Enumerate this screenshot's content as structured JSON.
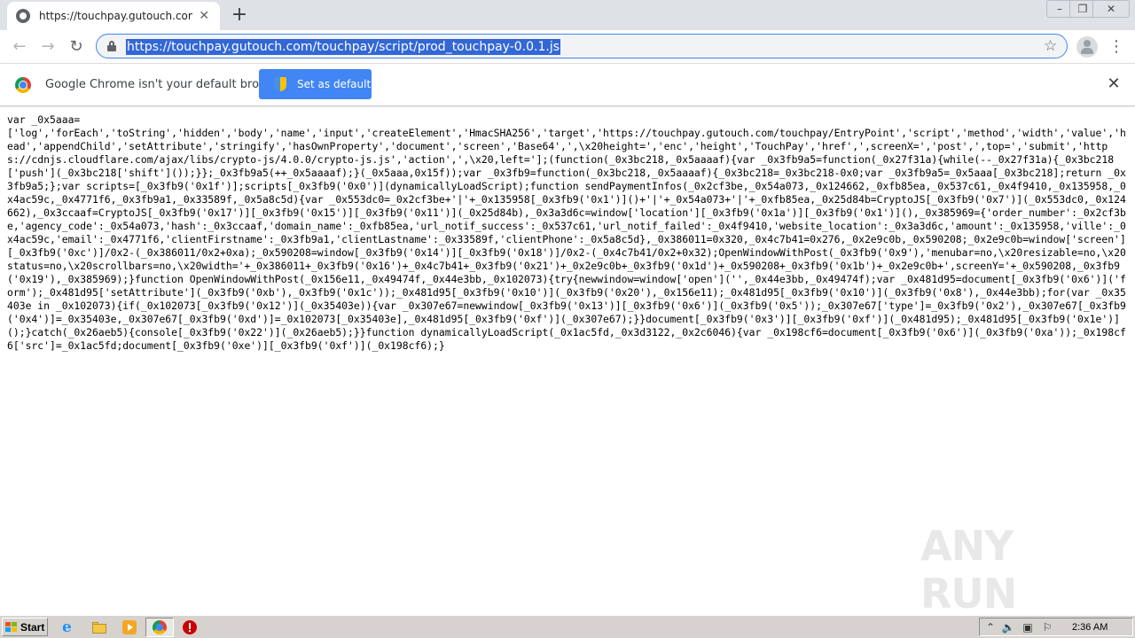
{
  "browser": {
    "tab": {
      "title": "https://touchpay.gutouch.com/touc",
      "close_glyph": "✕",
      "new_tab_glyph": "+"
    },
    "window_controls": {
      "minimize": "–",
      "maximize": "❐",
      "close": "✕"
    },
    "toolbar": {
      "back_glyph": "←",
      "forward_glyph": "→",
      "reload_glyph": "↻",
      "url": "https://touchpay.gutouch.com/touchpay/script/prod_touchpay-0.0.1.js",
      "star_glyph": "☆",
      "menu_glyph": "⋮"
    },
    "infobar": {
      "message": "Google Chrome isn't your default browser",
      "button_label": "Set as default",
      "close_glyph": "✕"
    }
  },
  "page": {
    "source_text": "var _0x5aaa=\n['log','forEach','toString','hidden','body','name','input','createElement','HmacSHA256','target','https://touchpay.gutouch.com/touchpay/EntryPoint','script','method','width','value','head','appendChild','setAttribute','stringify','hasOwnProperty','document','screen','Base64',',\\x20height=','enc','height','TouchPay','href',',screenX=','post',',top=','submit','https://cdnjs.cloudflare.com/ajax/libs/crypto-js/4.0.0/crypto-js.js','action',',\\x20,left='];(function(_0x3bc218,_0x5aaaaf){var _0x3fb9a5=function(_0x27f31a){while(--_0x27f31a){_0x3bc218['push'](_0x3bc218['shift']());}};_0x3fb9a5(++_0x5aaaaf);}(_0x5aaa,0x15f));var _0x3fb9=function(_0x3bc218,_0x5aaaaf){_0x3bc218=_0x3bc218-0x0;var _0x3fb9a5=_0x5aaa[_0x3bc218];return _0x3fb9a5;};var scripts=[_0x3fb9('0x1f')];scripts[_0x3fb9('0x0')](dynamicallyLoadScript);function sendPaymentInfos(_0x2cf3be,_0x54a073,_0x124662,_0xfb85ea,_0x537c61,_0x4f9410,_0x135958,_0x4ac59c,_0x4771f6,_0x3fb9a1,_0x33589f,_0x5a8c5d){var _0x553dc0=_0x2cf3be+'|'+_0x135958[_0x3fb9('0x1')]()+'|'+_0x54a073+'|'+_0xfb85ea,_0x25d84b=CryptoJS[_0x3fb9('0x7')](_0x553dc0,_0x124662),_0x3ccaaf=CryptoJS[_0x3fb9('0x17')][_0x3fb9('0x15')][_0x3fb9('0x11')](_0x25d84b),_0x3a3d6c=window['location'][_0x3fb9('0x1a')][_0x3fb9('0x1')](),_0x385969={'order_number':_0x2cf3be,'agency_code':_0x54a073,'hash':_0x3ccaaf,'domain_name':_0xfb85ea,'url_notif_success':_0x537c61,'url_notif_failed':_0x4f9410,'website_location':_0x3a3d6c,'amount':_0x135958,'ville':_0x4ac59c,'email':_0x4771f6,'clientFirstname':_0x3fb9a1,'clientLastname':_0x33589f,'clientPhone':_0x5a8c5d},_0x386011=0x320,_0x4c7b41=0x276,_0x2e9c0b,_0x590208;_0x2e9c0b=window['screen'][_0x3fb9('0xc')]/0x2-(_0x386011/0x2+0xa);_0x590208=window[_0x3fb9('0x14')][_0x3fb9('0x18')]/0x2-(_0x4c7b41/0x2+0x32);OpenWindowWithPost(_0x3fb9('0x9'),'menubar=no,\\x20resizable=no,\\x20status=no,\\x20scrollbars=no,\\x20width='+_0x386011+_0x3fb9('0x16')+_0x4c7b41+_0x3fb9('0x21')+_0x2e9c0b+_0x3fb9('0x1d')+_0x590208+_0x3fb9('0x1b')+_0x2e9c0b+',screenY='+_0x590208,_0x3fb9('0x19'),_0x385969);}function OpenWindowWithPost(_0x156e11,_0x49474f,_0x44e3bb,_0x102073){try{newwindow=window['open']('',_0x44e3bb,_0x49474f);var _0x481d95=document[_0x3fb9('0x6')]('form');_0x481d95['setAttribute'](_0x3fb9('0xb'),_0x3fb9('0x1c'));_0x481d95[_0x3fb9('0x10')](_0x3fb9('0x20'),_0x156e11);_0x481d95[_0x3fb9('0x10')](_0x3fb9('0x8'),_0x44e3bb);for(var _0x35403e in _0x102073){if(_0x102073[_0x3fb9('0x12')](_0x35403e)){var _0x307e67=newwindow[_0x3fb9('0x13')][_0x3fb9('0x6')](_0x3fb9('0x5'));_0x307e67['type']=_0x3fb9('0x2'),_0x307e67[_0x3fb9('0x4')]=_0x35403e,_0x307e67[_0x3fb9('0xd')]=_0x102073[_0x35403e],_0x481d95[_0x3fb9('0xf')](_0x307e67);}}document[_0x3fb9('0x3')][_0x3fb9('0xf')](_0x481d95);_0x481d95[_0x3fb9('0x1e')]();}catch(_0x26aeb5){console[_0x3fb9('0x22')](_0x26aeb5);}}function dynamicallyLoadScript(_0x1ac5fd,_0x3d3122,_0x2c6046){var _0x198cf6=document[_0x3fb9('0x6')](_0x3fb9('0xa'));_0x198cf6['src']=_0x1ac5fd;document[_0x3fb9('0xe')][_0x3fb9('0xf')](_0x198cf6);}",
    "watermark": "ANY RUN"
  },
  "taskbar": {
    "start_label": "Start",
    "clock": "2:36 AM",
    "tray_up_glyph": "⌃",
    "tray_volume_glyph": "🔈",
    "tray_network_glyph": "▣",
    "tray_flag_glyph": "⚐"
  }
}
